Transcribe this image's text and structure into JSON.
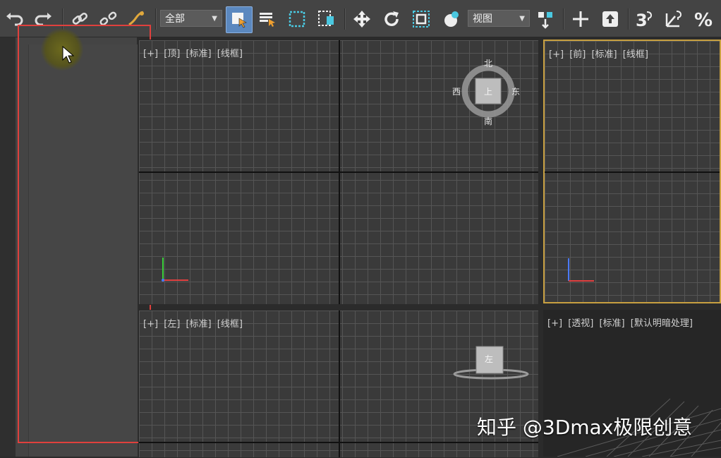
{
  "toolbar": {
    "selection_filter": "全部",
    "reference_coord": "视图",
    "icons": [
      "undo-icon",
      "redo-icon",
      "link-icon",
      "unlink-icon",
      "bind-space-warp-icon",
      "select-object-icon",
      "select-by-name-icon",
      "rect-selection-icon",
      "window-crossing-icon",
      "move-icon",
      "rotate-icon",
      "scale-icon",
      "pivot-icon",
      "snap-toggle-icon",
      "angle-snap-icon",
      "percent-snap-icon"
    ]
  },
  "viewports": {
    "top": {
      "plus": "[+]",
      "view": "[顶]",
      "shading": "[标准]",
      "mode": "[线框]"
    },
    "front": {
      "plus": "[+]",
      "view": "[前]",
      "shading": "[标准]",
      "mode": "[线框]"
    },
    "left": {
      "plus": "[+]",
      "view": "[左]",
      "shading": "[标准]",
      "mode": "[线框]"
    },
    "perspective": {
      "plus": "[+]",
      "view": "[透视]",
      "shading": "[标准]",
      "mode": "[默认明暗处理]"
    }
  },
  "viewcube": {
    "north": "北",
    "south": "南",
    "east": "东",
    "west": "西",
    "face_top": "上",
    "face_left": "左"
  },
  "axes": {
    "x": "x",
    "y": "y",
    "z": "z"
  },
  "watermark": "知乎 @3Dmax极限创意",
  "colors": {
    "highlight_outline": "#e0403d",
    "active_viewport_border": "#c8a040",
    "active_button": "#5b88bf"
  }
}
